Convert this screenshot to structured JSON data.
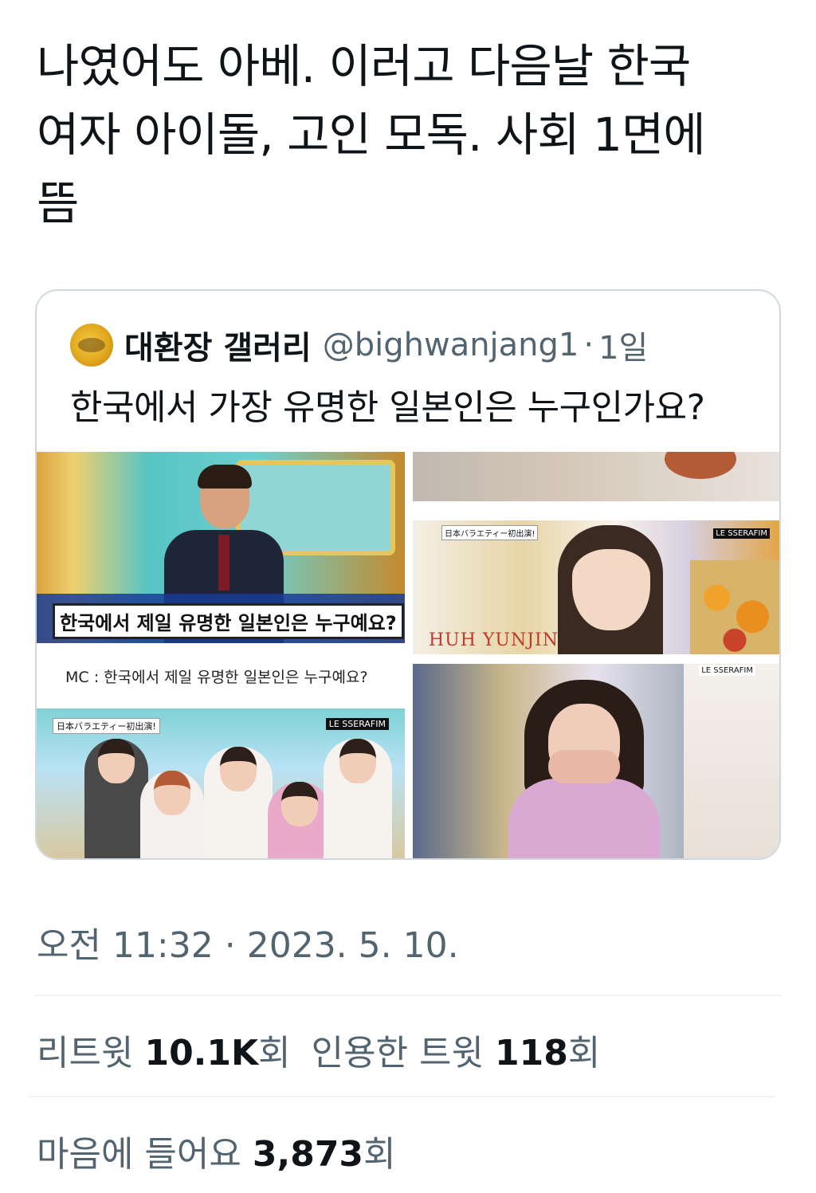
{
  "tweet": {
    "text_lines": [
      "나였어도 아베. 이러고 다음날 한국",
      "여자 아이돌, 고인 모독. 사회 1면에",
      "뜸"
    ],
    "timestamp": "오전 11:32 · 2023. 5. 10."
  },
  "quote": {
    "display_name": "대환장 갤러리",
    "handle": "@bighwanjang1",
    "dot": "·",
    "time_ago": "1일",
    "text": "한국에서 가장 유명한 일본인은 누구인가요?",
    "images": {
      "panel1_caption": "한국에서 제일 유명한 일본인은 누구예요?",
      "panel1_subtitle": "MC : 한국에서 제일 유명한 일본인은 누구예요?",
      "panel2_name": "HUH YUNJIN",
      "show_tag": "日本バラエティー初出演!",
      "group_tag": "LE SSERAFIM"
    }
  },
  "stats": {
    "retweets_label": "리트윗",
    "retweets_count": "10.1K",
    "retweets_unit": "회",
    "quotes_label": "인용한 트윗",
    "quotes_count": "118",
    "quotes_unit": "회",
    "likes_label": "마음에 들어요",
    "likes_count": "3,873",
    "likes_unit": "회"
  },
  "colors": {
    "text_primary": "#0f1419",
    "text_secondary": "#536471",
    "border": "#cfd9de",
    "divider": "#eff3f4"
  }
}
